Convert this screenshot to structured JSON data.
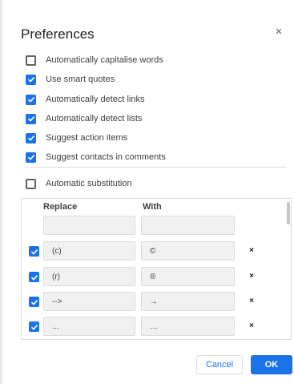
{
  "dialog": {
    "title": "Preferences",
    "close_glyph": "×"
  },
  "options": [
    {
      "label": "Automatically capitalise words",
      "checked": false
    },
    {
      "label": "Use smart quotes",
      "checked": true
    },
    {
      "label": "Automatically detect links",
      "checked": true
    },
    {
      "label": "Automatically detect lists",
      "checked": true
    },
    {
      "label": "Suggest action items",
      "checked": true
    },
    {
      "label": "Suggest contacts in comments",
      "checked": true
    }
  ],
  "substitution": {
    "label": "Automatic substitution",
    "checked": false,
    "columns": {
      "replace": "Replace",
      "with": "With"
    },
    "new_row": {
      "replace": "",
      "with": ""
    },
    "rows": [
      {
        "replace": "(c)",
        "with": "©",
        "checked": true
      },
      {
        "replace": "(r)",
        "with": "®",
        "checked": true
      },
      {
        "replace": "-->",
        "with": "→",
        "checked": true
      },
      {
        "replace": "...",
        "with": "…",
        "checked": true
      }
    ],
    "delete_glyph": "×"
  },
  "buttons": {
    "cancel": "Cancel",
    "ok": "OK"
  },
  "colors": {
    "accent": "#1a73e8",
    "checkbox_off_border": "#5f6368",
    "field_bg": "#f1f1f1"
  },
  "icons": {
    "close": "close-icon",
    "checkbox": "checkmark-icon",
    "delete": "delete-x-icon"
  }
}
